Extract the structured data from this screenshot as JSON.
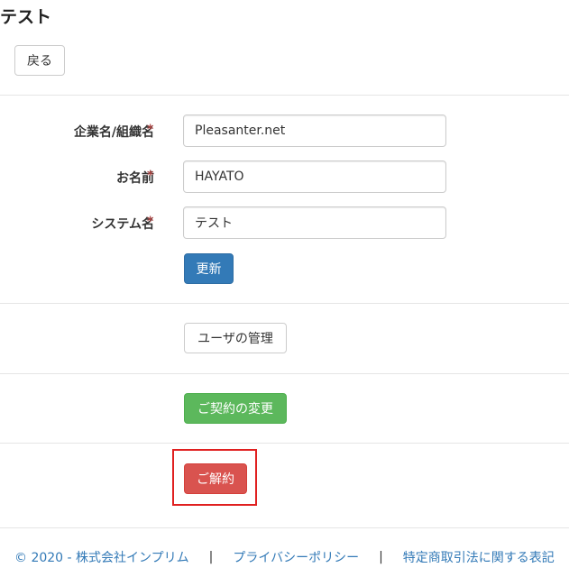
{
  "page": {
    "title": "テスト"
  },
  "back_button": {
    "label": "戻る"
  },
  "form": {
    "company": {
      "label": "企業名/組織名",
      "required_mark": "*",
      "value": "Pleasanter.net"
    },
    "name": {
      "label": "お名前",
      "required_mark": "*",
      "value": "HAYATO"
    },
    "system": {
      "label": "システム名",
      "required_mark": "*",
      "value": "テスト"
    },
    "update_button": "更新"
  },
  "manage_users_button": "ユーザの管理",
  "change_contract_button": "ご契約の変更",
  "cancel_contract_button": "ご解約",
  "footer": {
    "copyright": "© 2020 - 株式会社インプリム",
    "separator": "|",
    "privacy_link": "プライバシーポリシー",
    "commerce_link": "特定商取引法に関する表記"
  },
  "colors": {
    "primary": "#337ab7",
    "success": "#5cb85c",
    "danger": "#d9534f",
    "highlight_border": "#e02020",
    "required": "#a94442"
  }
}
